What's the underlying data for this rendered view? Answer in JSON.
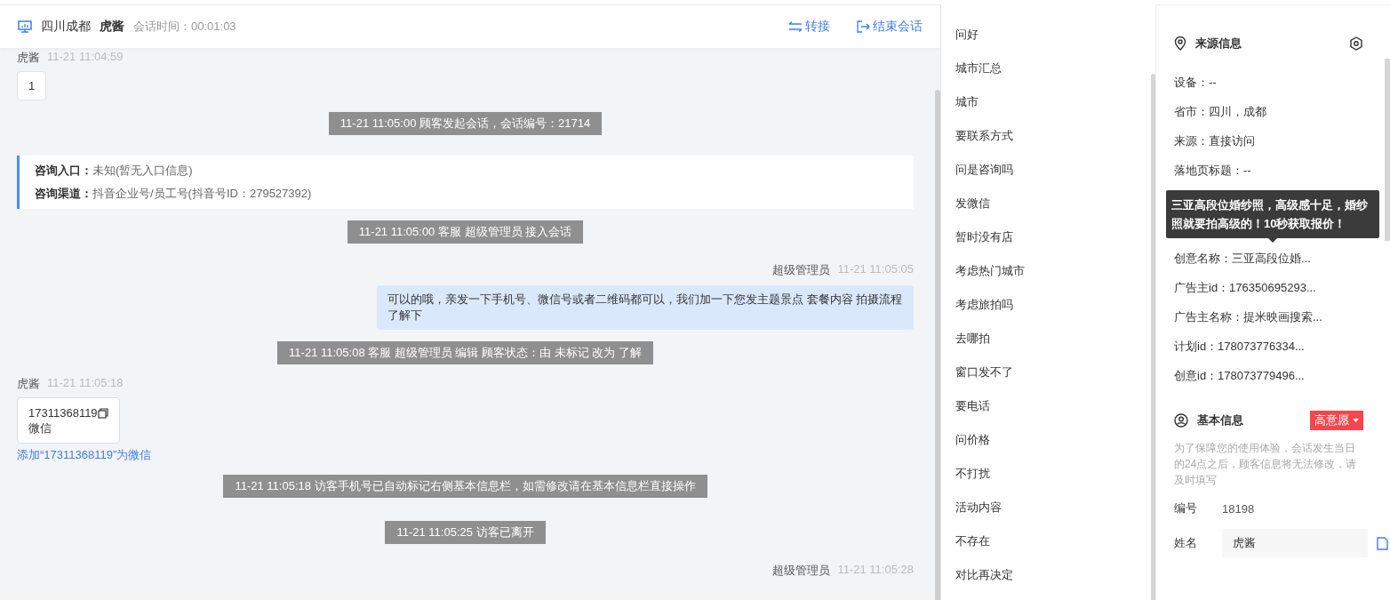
{
  "header": {
    "location": "四川成都",
    "visitor": "虎酱",
    "duration": "会话时间：00:01:03",
    "actions": [
      {
        "kind": "transfer",
        "label": "转接"
      },
      {
        "kind": "end",
        "label": "结束会话"
      }
    ]
  },
  "messages": [
    {
      "kind": "customer",
      "name": "虎酱",
      "time": "11-21 11:04:59",
      "text": "1"
    },
    {
      "kind": "system",
      "text": "11-21 11:05:00 顾客发起会话，会话编号：21714"
    },
    {
      "kind": "entry",
      "lines": [
        {
          "label": "咨询入口：",
          "value": "未知(暂无入口信息)"
        },
        {
          "label": "咨询渠道：",
          "value": "抖音企业号/员工号(抖音号ID：279527392)"
        }
      ]
    },
    {
      "kind": "system",
      "text": "11-21 11:05:00 客服 超级管理员 接入会话"
    },
    {
      "kind": "agent",
      "name": "超级管理员",
      "time": "11-21 11:05:05",
      "text": "可以的哦，亲发一下手机号、微信号或者二维码都可以，我们加一下您发主题景点 套餐内容 拍摄流程了解下"
    },
    {
      "kind": "system",
      "text": "11-21 11:05:08 客服 超级管理员 编辑 顾客状态：由 未标记 改为 了解"
    },
    {
      "kind": "contact",
      "name": "虎酱",
      "time": "11-21 11:05:18",
      "number": "17311368119",
      "type": "微信",
      "link": "添加“17311368119”为微信"
    },
    {
      "kind": "system",
      "text": "11-21 11:05:18 访客手机号已自动标记右侧基本信息栏，如需修改请在基本信息栏直接操作"
    },
    {
      "kind": "system",
      "text": "11-21 11:05:25 访客已离开"
    },
    {
      "kind": "agent",
      "name": "超级管理员",
      "time": "11-21 11:05:28"
    }
  ],
  "quick_replies": [
    "问好",
    "城市汇总",
    "城市",
    "要联系方式",
    "问是咨询吗",
    "发微信",
    "暂时没有店",
    "考虑热门城市",
    "考虑旅拍吗",
    "去哪拍",
    "窗口发不了",
    "要电话",
    "问价格",
    "不打扰",
    "活动内容",
    "不存在",
    "对比再决定"
  ],
  "source_info": {
    "title": "来源信息",
    "rows": [
      {
        "kind": "text",
        "text": "设备：--"
      },
      {
        "kind": "text",
        "text": "省市：四川，成都"
      },
      {
        "kind": "text",
        "text": "来源：直接访问"
      },
      {
        "kind": "text",
        "text": "落地页标题：--"
      },
      {
        "kind": "covered"
      },
      {
        "kind": "covered"
      },
      {
        "kind": "text",
        "text": "创意名称：三亚高段位婚..."
      },
      {
        "kind": "text",
        "text": "广告主id：176350695293..."
      },
      {
        "kind": "text",
        "text": "广告主名称：提米映画搜索..."
      },
      {
        "kind": "text",
        "text": "计划id：178073776334..."
      },
      {
        "kind": "text",
        "text": "创意id：178073779496..."
      }
    ],
    "tooltip": "三亚高段位婚纱照，高级感十足，婚纱照就要拍高级的！10秒获取报价！"
  },
  "basic_info": {
    "title": "基本信息",
    "intent_tag": "高意愿",
    "note": "为了保障您的使用体验，会话发生当日的24点之后，顾客信息将无法修改，请及时填写",
    "fields": [
      {
        "kind": "text",
        "label": "编号",
        "value": "18198"
      },
      {
        "kind": "input",
        "label": "姓名",
        "value": "虎酱"
      }
    ]
  }
}
